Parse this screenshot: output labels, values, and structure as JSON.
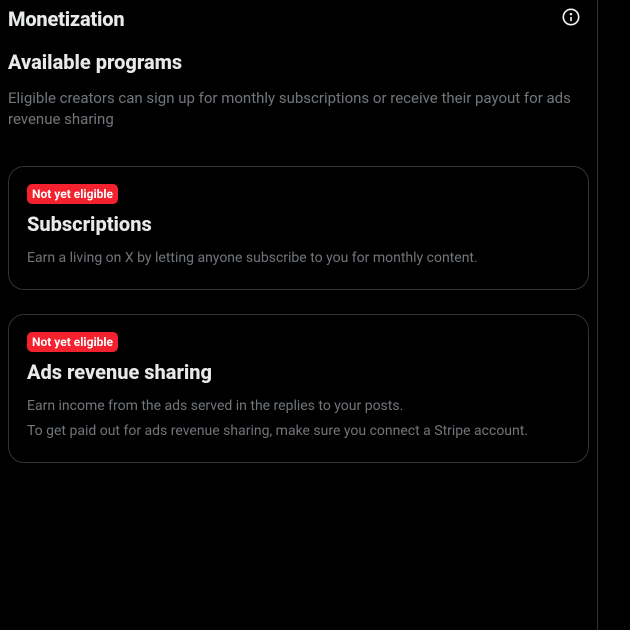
{
  "header": {
    "title": "Monetization"
  },
  "section": {
    "title": "Available programs",
    "description": "Eligible creators can sign up for monthly subscriptions or receive their payout for ads revenue sharing"
  },
  "programs": [
    {
      "badge": "Not yet eligible",
      "title": "Subscriptions",
      "description_lines": [
        "Earn a living on X by letting anyone subscribe to you for monthly content."
      ]
    },
    {
      "badge": "Not yet eligible",
      "title": "Ads revenue sharing",
      "description_lines": [
        "Earn income from the ads served in the replies to your posts.",
        "To get paid out for ads revenue sharing, make sure you connect a Stripe account."
      ]
    }
  ],
  "colors": {
    "background": "#000000",
    "text_primary": "#e7e9ea",
    "text_secondary": "#71767b",
    "border": "#2f3336",
    "badge_bg": "#f4212e",
    "badge_text": "#ffffff"
  }
}
